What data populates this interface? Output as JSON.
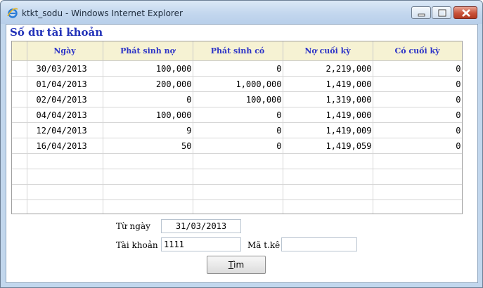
{
  "window": {
    "title": "ktkt_sodu - Windows Internet Explorer"
  },
  "heading": "Số dư tài khoản",
  "table": {
    "columns": [
      "",
      "Ngày",
      "Phát sinh nợ",
      "Phát sinh có",
      "Nợ cuối kỳ",
      "Có cuối kỳ"
    ],
    "rows": [
      {
        "date": "30/03/2013",
        "debit": "100,000",
        "credit": "0",
        "end_debit": "2,219,000",
        "end_credit": "0"
      },
      {
        "date": "01/04/2013",
        "debit": "200,000",
        "credit": "1,000,000",
        "end_debit": "1,419,000",
        "end_credit": "0"
      },
      {
        "date": "02/04/2013",
        "debit": "0",
        "credit": "100,000",
        "end_debit": "1,319,000",
        "end_credit": "0"
      },
      {
        "date": "04/04/2013",
        "debit": "100,000",
        "credit": "0",
        "end_debit": "1,419,000",
        "end_credit": "0"
      },
      {
        "date": "12/04/2013",
        "debit": "9",
        "credit": "0",
        "end_debit": "1,419,009",
        "end_credit": "0"
      },
      {
        "date": "16/04/2013",
        "debit": "50",
        "credit": "0",
        "end_debit": "1,419,059",
        "end_credit": "0"
      }
    ]
  },
  "form": {
    "from_date_label": "Từ ngày",
    "from_date_value": "31/03/2013",
    "account_label": "Tài khoản",
    "account_value": "1111",
    "stat_code_label": "Mã t.kê",
    "stat_code_value": "",
    "search_button_first": "T",
    "search_button_rest": "ìm"
  },
  "colors": {
    "heading": "#2232b8",
    "header_bg": "#f6f2d3",
    "header_text": "#2d34c7"
  },
  "icons": [
    "internet-explorer-icon",
    "minimize-icon",
    "maximize-icon",
    "close-icon"
  ]
}
